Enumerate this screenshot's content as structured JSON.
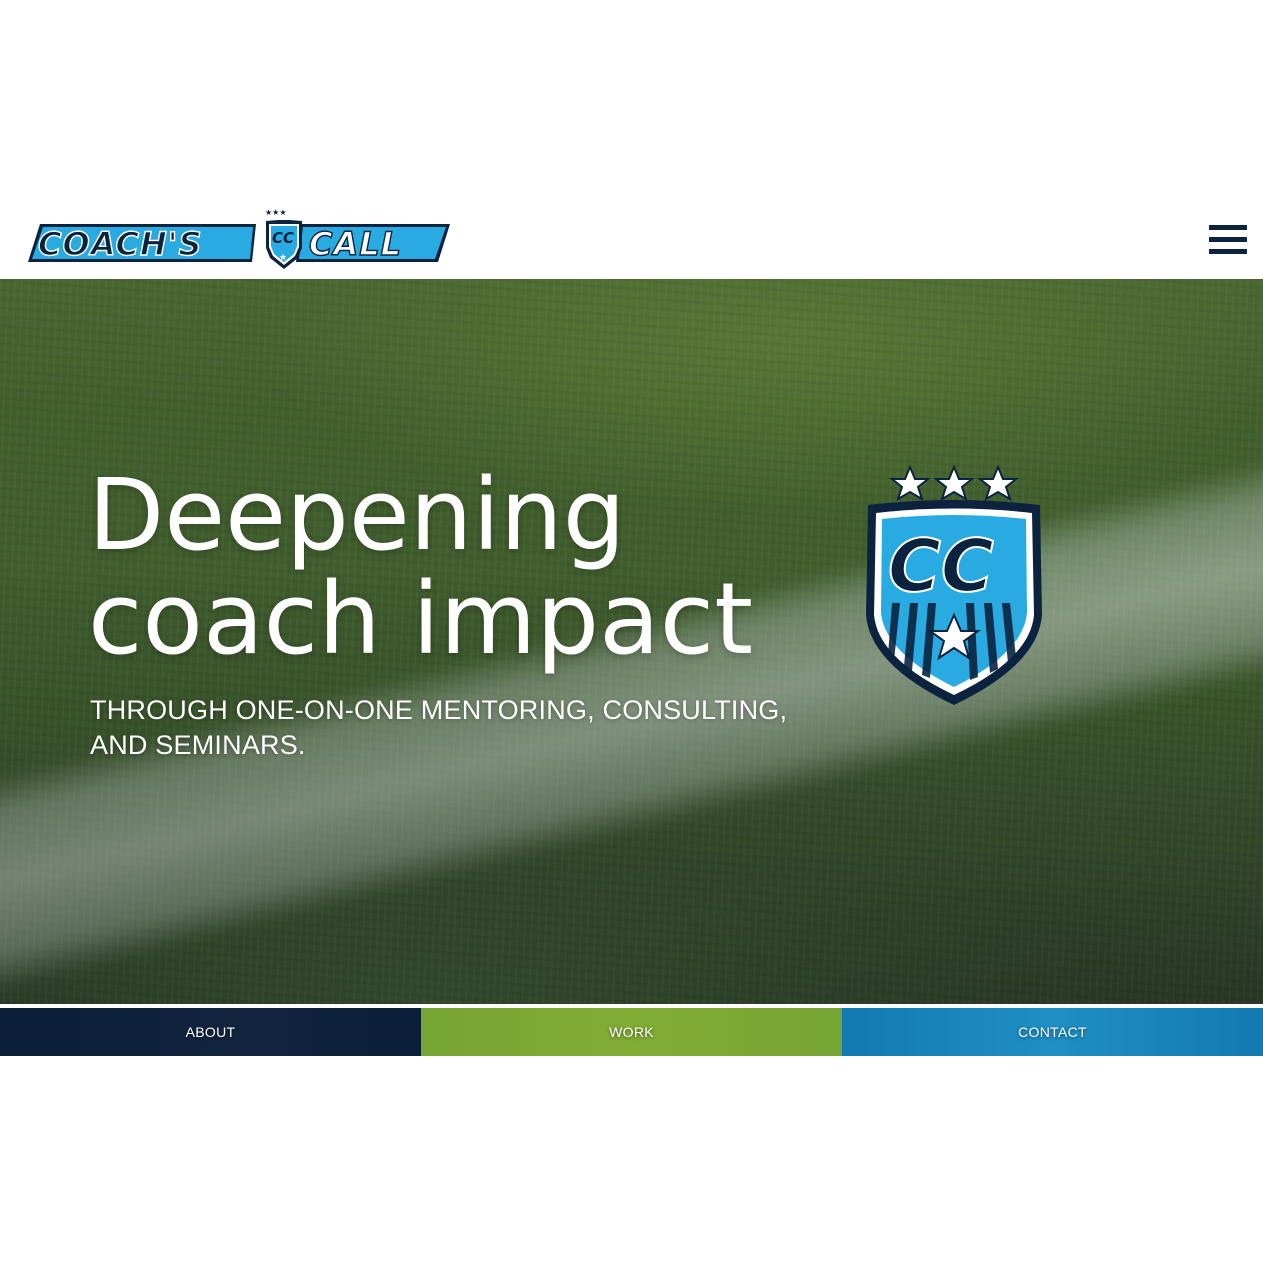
{
  "header": {
    "logo_text": "COACH'S CC CALL",
    "menu_icon": "hamburger-menu-icon"
  },
  "hero": {
    "title_line1": "Deepening",
    "title_line2": "coach impact",
    "subtitle": "THROUGH ONE-ON-ONE MENTORING, CONSULTING, AND SEMINARS.",
    "crest_text": "CC"
  },
  "nav": {
    "items": [
      {
        "label": "ABOUT",
        "color": "#0c2340"
      },
      {
        "label": "WORK",
        "color": "#7eab35"
      },
      {
        "label": "CONTACT",
        "color": "#1a86bd"
      }
    ]
  },
  "colors": {
    "navy": "#0c2340",
    "light_blue": "#29abe2",
    "green": "#7eab35",
    "blue": "#1a86bd"
  }
}
